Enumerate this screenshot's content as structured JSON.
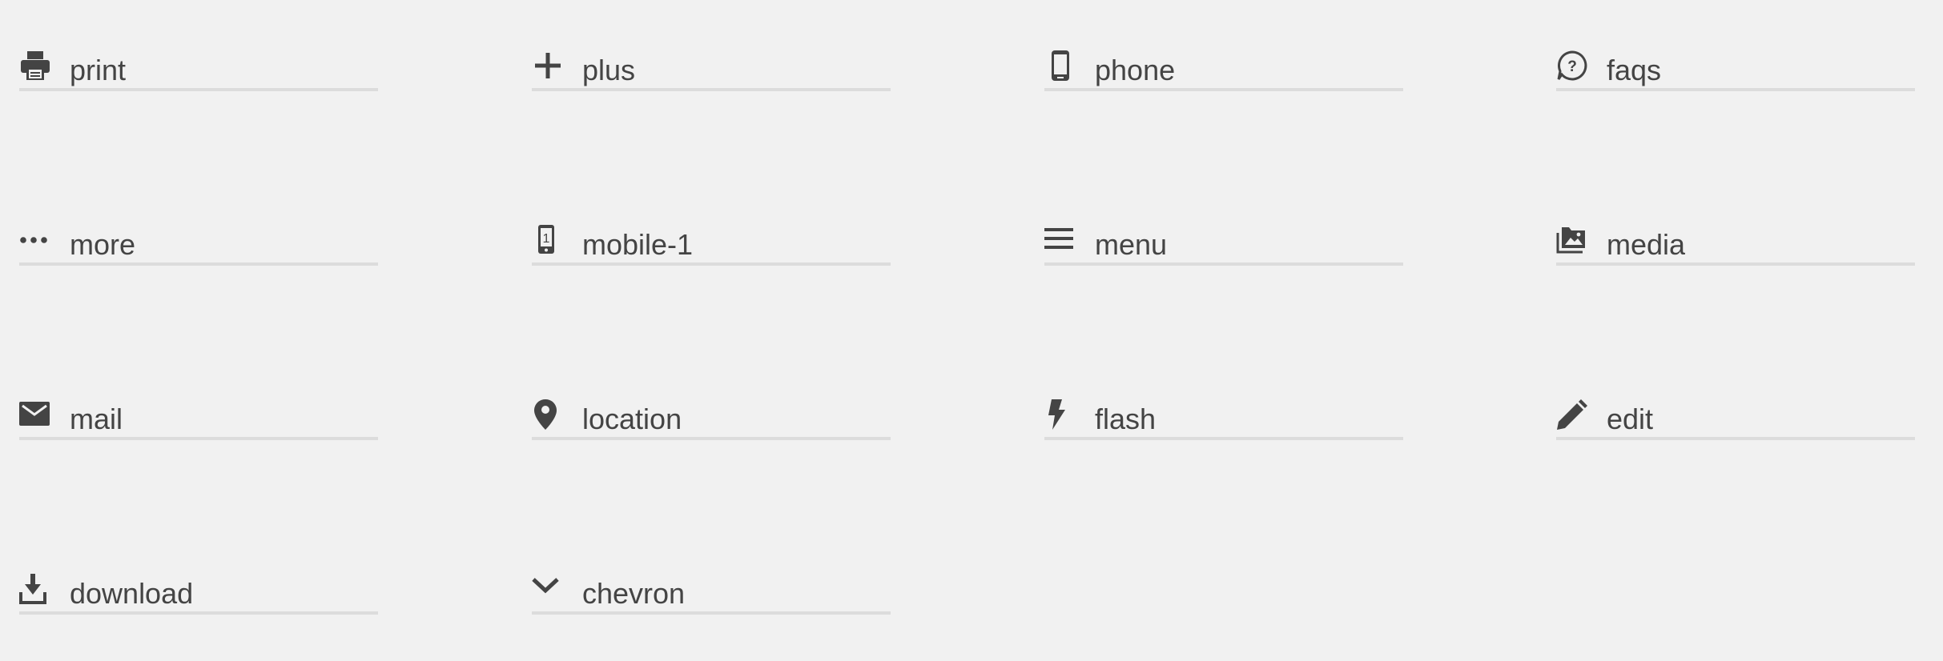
{
  "icons": [
    {
      "name": "print",
      "icon": "print-icon"
    },
    {
      "name": "plus",
      "icon": "plus-icon"
    },
    {
      "name": "phone",
      "icon": "phone-icon"
    },
    {
      "name": "faqs",
      "icon": "faqs-icon"
    },
    {
      "name": "more",
      "icon": "more-icon"
    },
    {
      "name": "mobile-1",
      "icon": "mobile-1-icon"
    },
    {
      "name": "menu",
      "icon": "menu-icon"
    },
    {
      "name": "media",
      "icon": "media-icon"
    },
    {
      "name": "mail",
      "icon": "mail-icon"
    },
    {
      "name": "location",
      "icon": "location-icon"
    },
    {
      "name": "flash",
      "icon": "flash-icon"
    },
    {
      "name": "edit",
      "icon": "edit-icon"
    },
    {
      "name": "download",
      "icon": "download-icon"
    },
    {
      "name": "chevron",
      "icon": "chevron-icon"
    }
  ],
  "colors": {
    "background": "#f1f1f1",
    "text": "#444444",
    "icon": "#444444",
    "underline": "#dcdcdc"
  }
}
